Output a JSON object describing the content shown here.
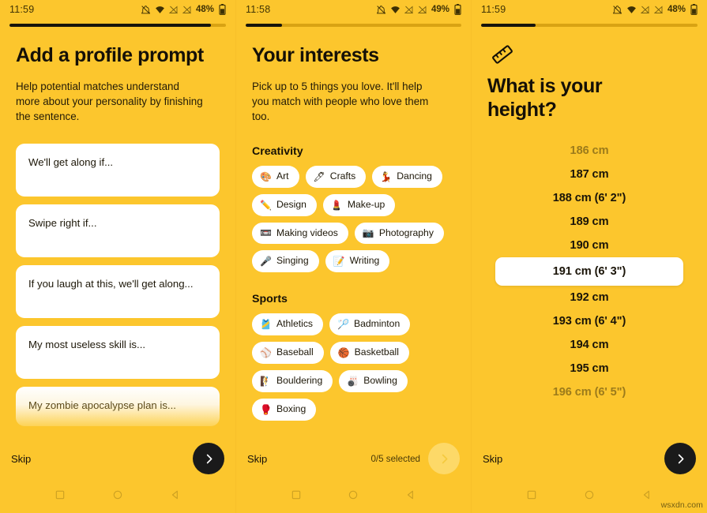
{
  "app": {
    "background_color": "#FCC62D",
    "card_color": "#FFFFFF",
    "accent_dark": "#1A1A1A",
    "watermark": "wsxdn.com"
  },
  "screens": [
    {
      "id": "profile-prompt",
      "status": {
        "time": "11:59",
        "battery": "48%"
      },
      "progress": 93,
      "title": "Add a profile prompt",
      "subtitle": "Help potential matches understand more about your personality by finishing the sentence.",
      "prompts": [
        {
          "text": "We'll get along if..."
        },
        {
          "text": "Swipe right if..."
        },
        {
          "text": "If you laugh at this, we'll get along..."
        },
        {
          "text": "My most useless skill is..."
        },
        {
          "text": "My zombie apocalypse plan is..."
        }
      ],
      "skip_label": "Skip",
      "next_enabled": true
    },
    {
      "id": "your-interests",
      "status": {
        "time": "11:58",
        "battery": "49%"
      },
      "progress": 17,
      "title": "Your interests",
      "subtitle": "Pick up to 5 things you love. It'll help you match with people who love them too.",
      "sections": [
        {
          "heading": "Creativity",
          "chips": [
            {
              "emoji": "🎨",
              "icon_name": "palette-icon",
              "label": "Art"
            },
            {
              "emoji": "🖊",
              "icon_name": "pen-icon",
              "label": "Crafts"
            },
            {
              "emoji": "💃",
              "icon_name": "dancer-icon",
              "label": "Dancing"
            },
            {
              "emoji": "✏️",
              "icon_name": "pencil-icon",
              "label": "Design"
            },
            {
              "emoji": "💄",
              "icon_name": "lipstick-icon",
              "label": "Make-up"
            },
            {
              "emoji": "📼",
              "icon_name": "videotape-icon",
              "label": "Making videos"
            },
            {
              "emoji": "📷",
              "icon_name": "camera-icon",
              "label": "Photography"
            },
            {
              "emoji": "🎤",
              "icon_name": "microphone-icon",
              "label": "Singing"
            },
            {
              "emoji": "📝",
              "icon_name": "memo-icon",
              "label": "Writing"
            }
          ]
        },
        {
          "heading": "Sports",
          "chips": [
            {
              "emoji": "🎽",
              "icon_name": "running-shirt-icon",
              "label": "Athletics"
            },
            {
              "emoji": "🏸",
              "icon_name": "badminton-icon",
              "label": "Badminton"
            },
            {
              "emoji": "⚾",
              "icon_name": "baseball-icon",
              "label": "Baseball"
            },
            {
              "emoji": "🏀",
              "icon_name": "basketball-icon",
              "label": "Basketball"
            },
            {
              "emoji": "🧗",
              "icon_name": "climbing-icon",
              "label": "Bouldering"
            },
            {
              "emoji": "🎳",
              "icon_name": "bowling-icon",
              "label": "Bowling"
            },
            {
              "emoji": "🥊",
              "icon_name": "boxing-glove-icon",
              "label": "Boxing"
            }
          ]
        }
      ],
      "skip_label": "Skip",
      "selected_count_label": "0/5 selected",
      "next_enabled": false
    },
    {
      "id": "height",
      "status": {
        "time": "11:59",
        "battery": "48%"
      },
      "progress": 25,
      "title": "What is your height?",
      "icon_name": "ruler-icon",
      "heights": [
        {
          "label": "186 cm",
          "state": "dim"
        },
        {
          "label": "187 cm",
          "state": "normal"
        },
        {
          "label": "188 cm (6' 2\")",
          "state": "normal"
        },
        {
          "label": "189 cm",
          "state": "normal"
        },
        {
          "label": "190 cm",
          "state": "normal"
        },
        {
          "label": "191 cm (6' 3\")",
          "state": "selected"
        },
        {
          "label": "192 cm",
          "state": "normal"
        },
        {
          "label": "193 cm (6' 4\")",
          "state": "normal"
        },
        {
          "label": "194 cm",
          "state": "normal"
        },
        {
          "label": "195 cm",
          "state": "normal"
        },
        {
          "label": "196 cm (6' 5\")",
          "state": "dim"
        }
      ],
      "skip_label": "Skip",
      "next_enabled": true
    }
  ],
  "navbar": {
    "recents_label": "recents",
    "home_label": "home",
    "back_label": "back"
  }
}
